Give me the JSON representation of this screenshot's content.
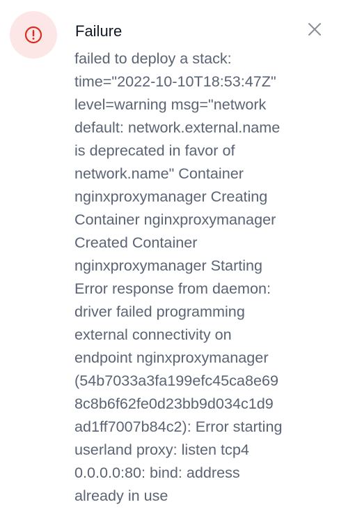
{
  "notification": {
    "title": "Failure",
    "icon": "exclamation-circle-icon",
    "close_icon": "close-icon",
    "accent_color": "#d92d20",
    "icon_background": "#fde6e6",
    "message": "failed to deploy a stack:\ntime=\"2022-10-10T18:53:47Z\"\nlevel=warning msg=\"network\ndefault: network.external.name\nis deprecated in favor of\nnetwork.name\" Container\nnginxproxymanager Creating\nContainer nginxproxymanager\nCreated Container\nnginxproxymanager Starting\nError response from daemon:\ndriver failed programming\nexternal connectivity on\nendpoint nginxproxymanager\n(54b7033a3fa199efc45ca8e69\n8c8b6f62fe0d23bb9d034c1d9\nad1ff7007b84c2): Error starting\nuserland proxy: listen tcp4\n0.0.0.0:80: bind: address\nalready in use"
  }
}
